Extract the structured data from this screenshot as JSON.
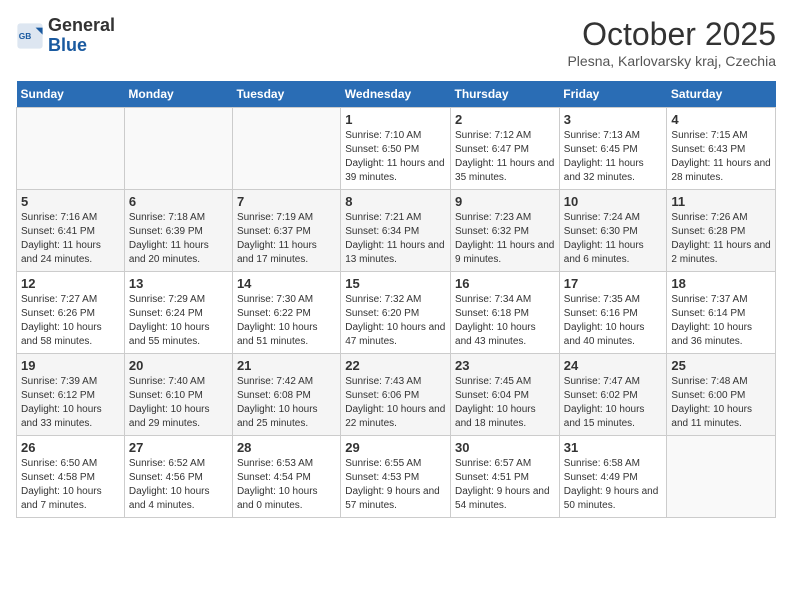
{
  "logo": {
    "general": "General",
    "blue": "Blue"
  },
  "header": {
    "month": "October 2025",
    "location": "Plesna, Karlovarsky kraj, Czechia"
  },
  "weekdays": [
    "Sunday",
    "Monday",
    "Tuesday",
    "Wednesday",
    "Thursday",
    "Friday",
    "Saturday"
  ],
  "weeks": [
    [
      {
        "day": "",
        "sunrise": "",
        "sunset": "",
        "daylight": ""
      },
      {
        "day": "",
        "sunrise": "",
        "sunset": "",
        "daylight": ""
      },
      {
        "day": "",
        "sunrise": "",
        "sunset": "",
        "daylight": ""
      },
      {
        "day": "1",
        "sunrise": "Sunrise: 7:10 AM",
        "sunset": "Sunset: 6:50 PM",
        "daylight": "Daylight: 11 hours and 39 minutes."
      },
      {
        "day": "2",
        "sunrise": "Sunrise: 7:12 AM",
        "sunset": "Sunset: 6:47 PM",
        "daylight": "Daylight: 11 hours and 35 minutes."
      },
      {
        "day": "3",
        "sunrise": "Sunrise: 7:13 AM",
        "sunset": "Sunset: 6:45 PM",
        "daylight": "Daylight: 11 hours and 32 minutes."
      },
      {
        "day": "4",
        "sunrise": "Sunrise: 7:15 AM",
        "sunset": "Sunset: 6:43 PM",
        "daylight": "Daylight: 11 hours and 28 minutes."
      }
    ],
    [
      {
        "day": "5",
        "sunrise": "Sunrise: 7:16 AM",
        "sunset": "Sunset: 6:41 PM",
        "daylight": "Daylight: 11 hours and 24 minutes."
      },
      {
        "day": "6",
        "sunrise": "Sunrise: 7:18 AM",
        "sunset": "Sunset: 6:39 PM",
        "daylight": "Daylight: 11 hours and 20 minutes."
      },
      {
        "day": "7",
        "sunrise": "Sunrise: 7:19 AM",
        "sunset": "Sunset: 6:37 PM",
        "daylight": "Daylight: 11 hours and 17 minutes."
      },
      {
        "day": "8",
        "sunrise": "Sunrise: 7:21 AM",
        "sunset": "Sunset: 6:34 PM",
        "daylight": "Daylight: 11 hours and 13 minutes."
      },
      {
        "day": "9",
        "sunrise": "Sunrise: 7:23 AM",
        "sunset": "Sunset: 6:32 PM",
        "daylight": "Daylight: 11 hours and 9 minutes."
      },
      {
        "day": "10",
        "sunrise": "Sunrise: 7:24 AM",
        "sunset": "Sunset: 6:30 PM",
        "daylight": "Daylight: 11 hours and 6 minutes."
      },
      {
        "day": "11",
        "sunrise": "Sunrise: 7:26 AM",
        "sunset": "Sunset: 6:28 PM",
        "daylight": "Daylight: 11 hours and 2 minutes."
      }
    ],
    [
      {
        "day": "12",
        "sunrise": "Sunrise: 7:27 AM",
        "sunset": "Sunset: 6:26 PM",
        "daylight": "Daylight: 10 hours and 58 minutes."
      },
      {
        "day": "13",
        "sunrise": "Sunrise: 7:29 AM",
        "sunset": "Sunset: 6:24 PM",
        "daylight": "Daylight: 10 hours and 55 minutes."
      },
      {
        "day": "14",
        "sunrise": "Sunrise: 7:30 AM",
        "sunset": "Sunset: 6:22 PM",
        "daylight": "Daylight: 10 hours and 51 minutes."
      },
      {
        "day": "15",
        "sunrise": "Sunrise: 7:32 AM",
        "sunset": "Sunset: 6:20 PM",
        "daylight": "Daylight: 10 hours and 47 minutes."
      },
      {
        "day": "16",
        "sunrise": "Sunrise: 7:34 AM",
        "sunset": "Sunset: 6:18 PM",
        "daylight": "Daylight: 10 hours and 43 minutes."
      },
      {
        "day": "17",
        "sunrise": "Sunrise: 7:35 AM",
        "sunset": "Sunset: 6:16 PM",
        "daylight": "Daylight: 10 hours and 40 minutes."
      },
      {
        "day": "18",
        "sunrise": "Sunrise: 7:37 AM",
        "sunset": "Sunset: 6:14 PM",
        "daylight": "Daylight: 10 hours and 36 minutes."
      }
    ],
    [
      {
        "day": "19",
        "sunrise": "Sunrise: 7:39 AM",
        "sunset": "Sunset: 6:12 PM",
        "daylight": "Daylight: 10 hours and 33 minutes."
      },
      {
        "day": "20",
        "sunrise": "Sunrise: 7:40 AM",
        "sunset": "Sunset: 6:10 PM",
        "daylight": "Daylight: 10 hours and 29 minutes."
      },
      {
        "day": "21",
        "sunrise": "Sunrise: 7:42 AM",
        "sunset": "Sunset: 6:08 PM",
        "daylight": "Daylight: 10 hours and 25 minutes."
      },
      {
        "day": "22",
        "sunrise": "Sunrise: 7:43 AM",
        "sunset": "Sunset: 6:06 PM",
        "daylight": "Daylight: 10 hours and 22 minutes."
      },
      {
        "day": "23",
        "sunrise": "Sunrise: 7:45 AM",
        "sunset": "Sunset: 6:04 PM",
        "daylight": "Daylight: 10 hours and 18 minutes."
      },
      {
        "day": "24",
        "sunrise": "Sunrise: 7:47 AM",
        "sunset": "Sunset: 6:02 PM",
        "daylight": "Daylight: 10 hours and 15 minutes."
      },
      {
        "day": "25",
        "sunrise": "Sunrise: 7:48 AM",
        "sunset": "Sunset: 6:00 PM",
        "daylight": "Daylight: 10 hours and 11 minutes."
      }
    ],
    [
      {
        "day": "26",
        "sunrise": "Sunrise: 6:50 AM",
        "sunset": "Sunset: 4:58 PM",
        "daylight": "Daylight: 10 hours and 7 minutes."
      },
      {
        "day": "27",
        "sunrise": "Sunrise: 6:52 AM",
        "sunset": "Sunset: 4:56 PM",
        "daylight": "Daylight: 10 hours and 4 minutes."
      },
      {
        "day": "28",
        "sunrise": "Sunrise: 6:53 AM",
        "sunset": "Sunset: 4:54 PM",
        "daylight": "Daylight: 10 hours and 0 minutes."
      },
      {
        "day": "29",
        "sunrise": "Sunrise: 6:55 AM",
        "sunset": "Sunset: 4:53 PM",
        "daylight": "Daylight: 9 hours and 57 minutes."
      },
      {
        "day": "30",
        "sunrise": "Sunrise: 6:57 AM",
        "sunset": "Sunset: 4:51 PM",
        "daylight": "Daylight: 9 hours and 54 minutes."
      },
      {
        "day": "31",
        "sunrise": "Sunrise: 6:58 AM",
        "sunset": "Sunset: 4:49 PM",
        "daylight": "Daylight: 9 hours and 50 minutes."
      },
      {
        "day": "",
        "sunrise": "",
        "sunset": "",
        "daylight": ""
      }
    ]
  ]
}
